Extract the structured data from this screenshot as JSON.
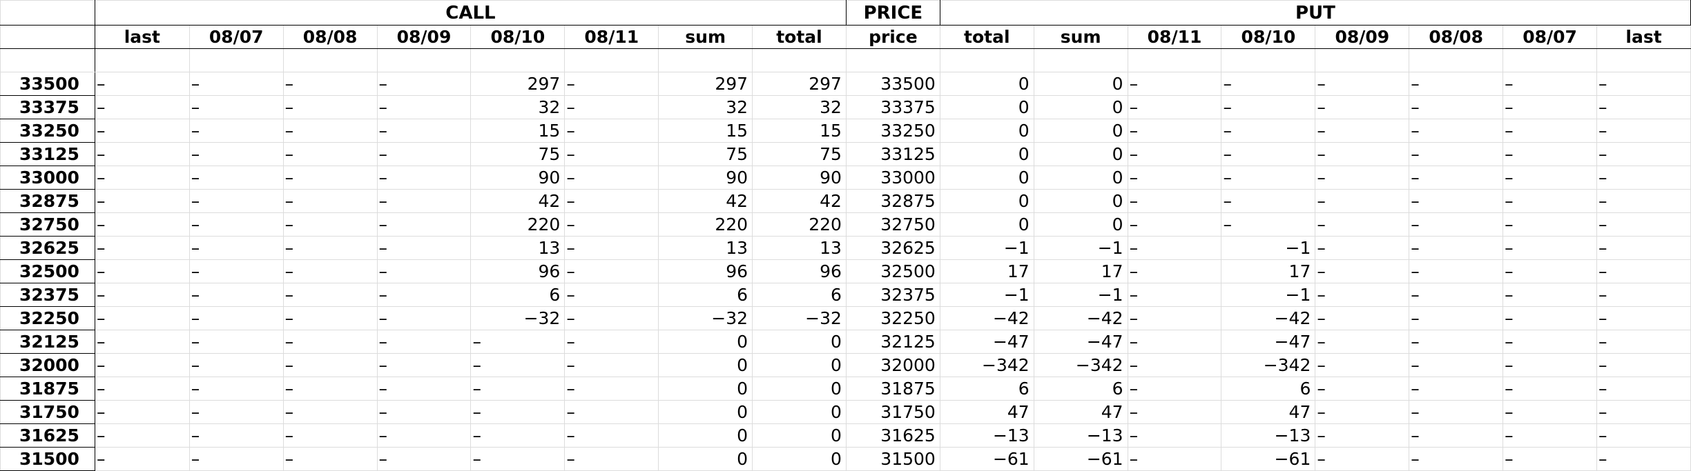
{
  "groups": {
    "call": "CALL",
    "price": "PRICE",
    "put": "PUT"
  },
  "columns": [
    "last",
    "08/07",
    "08/08",
    "08/09",
    "08/10",
    "08/11",
    "sum",
    "total",
    "price",
    "total",
    "sum",
    "08/11",
    "08/10",
    "08/09",
    "08/08",
    "08/07",
    "last"
  ],
  "rows": [
    [
      "33500",
      "–",
      "–",
      "–",
      "–",
      "297",
      "–",
      "297",
      "297",
      "33500",
      "0",
      "0",
      "–",
      "–",
      "–",
      "–",
      "–",
      "–"
    ],
    [
      "33375",
      "–",
      "–",
      "–",
      "–",
      "32",
      "–",
      "32",
      "32",
      "33375",
      "0",
      "0",
      "–",
      "–",
      "–",
      "–",
      "–",
      "–"
    ],
    [
      "33250",
      "–",
      "–",
      "–",
      "–",
      "15",
      "–",
      "15",
      "15",
      "33250",
      "0",
      "0",
      "–",
      "–",
      "–",
      "–",
      "–",
      "–"
    ],
    [
      "33125",
      "–",
      "–",
      "–",
      "–",
      "75",
      "–",
      "75",
      "75",
      "33125",
      "0",
      "0",
      "–",
      "–",
      "–",
      "–",
      "–",
      "–"
    ],
    [
      "33000",
      "–",
      "–",
      "–",
      "–",
      "90",
      "–",
      "90",
      "90",
      "33000",
      "0",
      "0",
      "–",
      "–",
      "–",
      "–",
      "–",
      "–"
    ],
    [
      "32875",
      "–",
      "–",
      "–",
      "–",
      "42",
      "–",
      "42",
      "42",
      "32875",
      "0",
      "0",
      "–",
      "–",
      "–",
      "–",
      "–",
      "–"
    ],
    [
      "32750",
      "–",
      "–",
      "–",
      "–",
      "220",
      "–",
      "220",
      "220",
      "32750",
      "0",
      "0",
      "–",
      "–",
      "–",
      "–",
      "–",
      "–"
    ],
    [
      "32625",
      "–",
      "–",
      "–",
      "–",
      "13",
      "–",
      "13",
      "13",
      "32625",
      "−1",
      "−1",
      "–",
      "−1",
      "–",
      "–",
      "–",
      "–"
    ],
    [
      "32500",
      "–",
      "–",
      "–",
      "–",
      "96",
      "–",
      "96",
      "96",
      "32500",
      "17",
      "17",
      "–",
      "17",
      "–",
      "–",
      "–",
      "–"
    ],
    [
      "32375",
      "–",
      "–",
      "–",
      "–",
      "6",
      "–",
      "6",
      "6",
      "32375",
      "−1",
      "−1",
      "–",
      "−1",
      "–",
      "–",
      "–",
      "–"
    ],
    [
      "32250",
      "–",
      "–",
      "–",
      "–",
      "−32",
      "–",
      "−32",
      "−32",
      "32250",
      "−42",
      "−42",
      "–",
      "−42",
      "–",
      "–",
      "–",
      "–"
    ],
    [
      "32125",
      "–",
      "–",
      "–",
      "–",
      "–",
      "–",
      "0",
      "0",
      "32125",
      "−47",
      "−47",
      "–",
      "−47",
      "–",
      "–",
      "–",
      "–"
    ],
    [
      "32000",
      "–",
      "–",
      "–",
      "–",
      "–",
      "–",
      "0",
      "0",
      "32000",
      "−342",
      "−342",
      "–",
      "−342",
      "–",
      "–",
      "–",
      "–"
    ],
    [
      "31875",
      "–",
      "–",
      "–",
      "–",
      "–",
      "–",
      "0",
      "0",
      "31875",
      "6",
      "6",
      "–",
      "6",
      "–",
      "–",
      "–",
      "–"
    ],
    [
      "31750",
      "–",
      "–",
      "–",
      "–",
      "–",
      "–",
      "0",
      "0",
      "31750",
      "47",
      "47",
      "–",
      "47",
      "–",
      "–",
      "–",
      "–"
    ],
    [
      "31625",
      "–",
      "–",
      "–",
      "–",
      "–",
      "–",
      "0",
      "0",
      "31625",
      "−13",
      "−13",
      "–",
      "−13",
      "–",
      "–",
      "–",
      "–"
    ],
    [
      "31500",
      "–",
      "–",
      "–",
      "–",
      "–",
      "–",
      "0",
      "0",
      "31500",
      "−61",
      "−61",
      "–",
      "−61",
      "–",
      "–",
      "–",
      "–"
    ]
  ]
}
